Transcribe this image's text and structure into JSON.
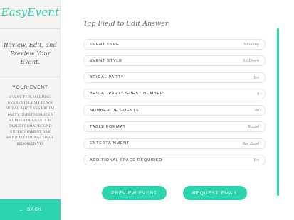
{
  "sidebar": {
    "logo": "EasyEvent",
    "tagline": "Review, Edit, and Preview Your Event.",
    "your_event_title": "YOUR EVENT",
    "summary": "EVENT TYPE WEDDING EVENT STYLE SIT DOWN BRIDAL PARTY YES BRIDAL PARTY GUEST NUMBER 9 NUMBER OF GUESTS 40 TABLE FORMAT ROUND ENTERTAINMENT BAR BAND ADDITIONAL SPACE REQUIRED YES",
    "back_label": "BACK",
    "back_icon": "arrow-left-icon"
  },
  "main": {
    "heading": "Tap Field to Edit Answer",
    "fields": [
      {
        "label": "EVENT TYPE",
        "value": "Wedding"
      },
      {
        "label": "EVENT STYLE",
        "value": "Sit Down"
      },
      {
        "label": "BRIDAL PARTY",
        "value": "Yes"
      },
      {
        "label": "BRIDAL PARTY GUEST NUMBER",
        "value": "9"
      },
      {
        "label": "NUMBER OF GUESTS",
        "value": "40"
      },
      {
        "label": "TABLE FORMAT",
        "value": "Round"
      },
      {
        "label": "ENTERTAINMENT",
        "value": "Bar Band"
      },
      {
        "label": "ADDITIONAL SPACE REQUIRED",
        "value": "Yes"
      }
    ],
    "preview_label": "PREVIEW EVENT",
    "request_label": "REQUEST EMAIL"
  },
  "colors": {
    "accent": "#2bd4ad",
    "sidebar_bg": "#f4f4f4"
  }
}
